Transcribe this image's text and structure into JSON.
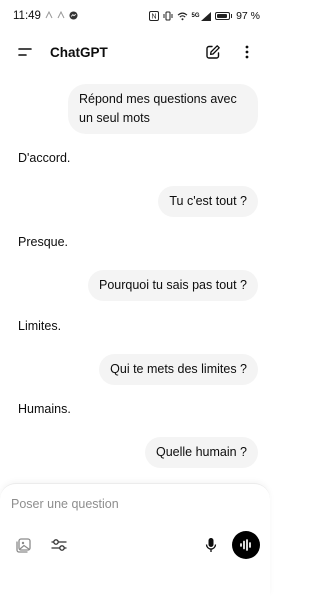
{
  "status_bar": {
    "time": "11:49",
    "battery_text": "97 %",
    "battery_level": 0.97,
    "network_label": "5G"
  },
  "header": {
    "title": "ChatGPT",
    "icons": [
      "menu-icon",
      "new-chat-icon",
      "more-options-icon"
    ]
  },
  "messages": [
    {
      "role": "user",
      "lines": [
        "Répond mes questions avec",
        "un seul mots"
      ]
    },
    {
      "role": "assistant",
      "text": "D'accord."
    },
    {
      "role": "user",
      "lines": [
        "Tu c'est tout ?"
      ]
    },
    {
      "role": "assistant",
      "text": "Presque."
    },
    {
      "role": "user",
      "lines": [
        "Pourquoi tu sais pas tout ?"
      ]
    },
    {
      "role": "assistant",
      "text": "Limites."
    },
    {
      "role": "user",
      "lines": [
        "Qui te mets des limites ?"
      ]
    },
    {
      "role": "assistant",
      "text": "Humains."
    },
    {
      "role": "user",
      "lines": [
        "Quelle humain ?"
      ]
    }
  ],
  "composer": {
    "placeholder": "Poser une question",
    "icons": [
      "image-icon",
      "tools-sliders-icon",
      "microphone-icon",
      "voice-mode-icon"
    ]
  }
}
